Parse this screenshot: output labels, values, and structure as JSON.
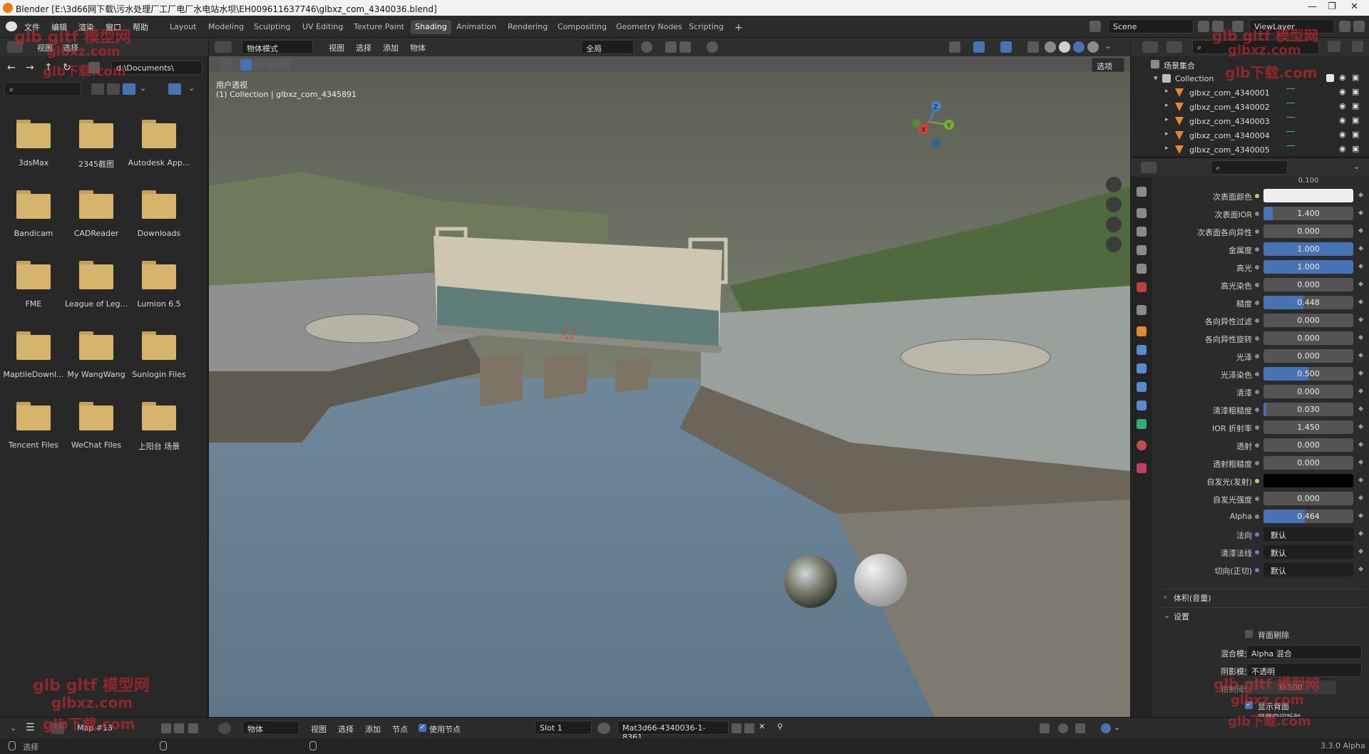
{
  "window": {
    "title": "Blender [E:\\3d66网下载\\污水处理厂工厂电厂水电站水坝\\EH009611637746\\glbxz_com_4340036.blend]",
    "controls": [
      "—",
      "❐",
      "✕"
    ]
  },
  "menu": [
    "文件",
    "编辑",
    "渲染",
    "窗口",
    "帮助"
  ],
  "workspaces": [
    {
      "label": "Layout",
      "active": false
    },
    {
      "label": "Modeling",
      "active": false
    },
    {
      "label": "Sculpting",
      "active": false
    },
    {
      "label": "UV Editing",
      "active": false
    },
    {
      "label": "Texture Paint",
      "active": false
    },
    {
      "label": "Shading",
      "active": true
    },
    {
      "label": "Animation",
      "active": false
    },
    {
      "label": "Rendering",
      "active": false
    },
    {
      "label": "Compositing",
      "active": false
    },
    {
      "label": "Geometry Nodes",
      "active": false
    },
    {
      "label": "Scripting",
      "active": false
    }
  ],
  "scene": {
    "name": "Scene",
    "view_layer": "ViewLayer"
  },
  "file_browser": {
    "menu": [
      "视图",
      "选择"
    ],
    "path": "d:\\Documents\\",
    "items": [
      "3dsMax",
      "2345截图",
      "Autodesk App...",
      "Bandicam",
      "CADReader",
      "Downloads",
      "FME",
      "League of Leg...",
      "Lumion 6.5",
      "MaptileDownl...",
      "My WangWang",
      "Sunlogin Files",
      "Tencent Files",
      "WeChat Files",
      "上阳台 场景"
    ]
  },
  "viewport": {
    "mode": "物体模式",
    "menu": [
      "视图",
      "选择",
      "添加",
      "物体"
    ],
    "orientation": "全局",
    "options": "选项",
    "view_name": "用户透视",
    "collection_info": "(1) Collection | glbxz_com_4345891",
    "gizmo": {
      "z": "Z",
      "y": "Y",
      "x": "X"
    }
  },
  "outliner": {
    "root": "场景集合",
    "collection": "Collection",
    "objects": [
      "glbxz_com_4340001",
      "glbxz_com_4340002",
      "glbxz_com_4340003",
      "glbxz_com_4340004",
      "glbxz_com_4340005"
    ]
  },
  "properties": {
    "top_partial": "0.100",
    "rows": [
      {
        "label": "次表面颜色",
        "value": "",
        "type": "color",
        "color": "#eeeeee",
        "dot": "y"
      },
      {
        "label": "次表面IOR",
        "value": "1.400",
        "fill": 0.1,
        "dot": "g"
      },
      {
        "label": "次表面各向异性",
        "value": "0.000",
        "fill": 0,
        "dot": "g"
      },
      {
        "label": "金属度",
        "value": "1.000",
        "fill": 1,
        "dot": "g"
      },
      {
        "label": "高光",
        "value": "1.000",
        "fill": 1,
        "dot": "g"
      },
      {
        "label": "高光染色",
        "value": "0.000",
        "fill": 0,
        "dot": "g"
      },
      {
        "label": "糙度",
        "value": "0.448",
        "fill": 0.448,
        "dot": "g"
      },
      {
        "label": "各向异性过滤",
        "value": "0.000",
        "fill": 0,
        "dot": "g"
      },
      {
        "label": "各向异性旋转",
        "value": "0.000",
        "fill": 0,
        "dot": "g"
      },
      {
        "label": "光泽",
        "value": "0.000",
        "fill": 0,
        "dot": "g"
      },
      {
        "label": "光泽染色",
        "value": "0.500",
        "fill": 0.5,
        "dot": "g"
      },
      {
        "label": "清漆",
        "value": "0.000",
        "fill": 0,
        "dot": "g"
      },
      {
        "label": "清漆粗糙度",
        "value": "0.030",
        "fill": 0.03,
        "dot": "g"
      },
      {
        "label": "IOR 折射率",
        "value": "1.450",
        "fill": 0,
        "dot": "g"
      },
      {
        "label": "透射",
        "value": "0.000",
        "fill": 0,
        "dot": "g"
      },
      {
        "label": "透射粗糙度",
        "value": "0.000",
        "fill": 0,
        "dot": "g"
      },
      {
        "label": "自发光(发射)",
        "value": "",
        "type": "color",
        "color": "#000000",
        "dot": "y"
      },
      {
        "label": "自发光强度",
        "value": "0.000",
        "fill": 0,
        "dot": "g"
      },
      {
        "label": "Alpha",
        "value": "0.464",
        "fill": 0.464,
        "dot": "g"
      },
      {
        "label": "法向",
        "value": "默认",
        "type": "text",
        "dot": "p"
      },
      {
        "label": "清漆法线",
        "value": "默认",
        "type": "text",
        "dot": "p"
      },
      {
        "label": "切向(正切)",
        "value": "默认",
        "type": "text",
        "dot": "p"
      }
    ],
    "section_volume": "体积(音量)",
    "section_settings": "设置",
    "backface_culling": "背面剔除",
    "blend_mode_label": "混合模式",
    "blend_mode": "Alpha 混合",
    "shadow_mode_label": "阴影模式",
    "shadow_mode": "不透明",
    "clip_threshold_label": "钳制阈值",
    "clip_threshold": "0.500",
    "show_backface": "显示背面",
    "screen_refraction": "屏幕空间折射"
  },
  "node_editor": {
    "image": "Map #13",
    "mode": "物体",
    "menu": [
      "视图",
      "选择",
      "添加",
      "节点"
    ],
    "use_nodes": "使用节点",
    "slot": "Slot 1",
    "material": "Mat3d66-4340036-1-8361"
  },
  "statusbar": {
    "left": "选择",
    "version": "3.3.0 Alpha"
  },
  "watermarks": [
    "glb gltf 模型网",
    "glbxz.com",
    "glb下载.com"
  ]
}
